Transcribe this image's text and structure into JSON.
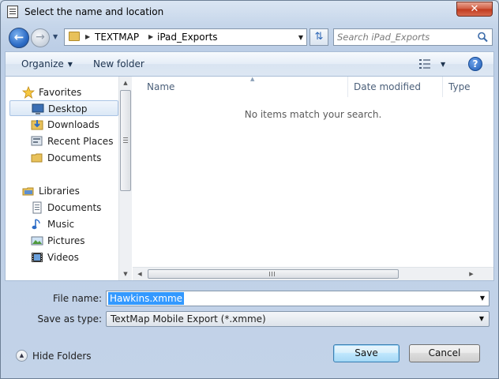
{
  "window": {
    "title": "Select the name and location",
    "close_label": "✕"
  },
  "address": {
    "crumbs": [
      "TEXTMAP",
      "iPad_Exports"
    ],
    "search_placeholder": "Search iPad_Exports"
  },
  "toolbar": {
    "organize_label": "Organize",
    "new_folder_label": "New folder",
    "help_label": "?"
  },
  "nav": {
    "favorites_label": "Favorites",
    "favorites": [
      {
        "label": "Desktop",
        "icon": "desktop-icon",
        "selected": true
      },
      {
        "label": "Downloads",
        "icon": "downloads-icon"
      },
      {
        "label": "Recent Places",
        "icon": "recent-places-icon"
      },
      {
        "label": "Documents",
        "icon": "folder-icon"
      }
    ],
    "libraries_label": "Libraries",
    "libraries": [
      {
        "label": "Documents",
        "icon": "documents-library-icon"
      },
      {
        "label": "Music",
        "icon": "music-icon"
      },
      {
        "label": "Pictures",
        "icon": "pictures-icon"
      },
      {
        "label": "Videos",
        "icon": "videos-icon"
      }
    ]
  },
  "file_list": {
    "columns": [
      "Name",
      "Date modified",
      "Type"
    ],
    "empty_message": "No items match your search."
  },
  "form": {
    "file_name_label": "File name:",
    "file_name_value": "Hawkins.xmme",
    "save_type_label": "Save as type:",
    "save_type_value": "TextMap Mobile Export (*.xmme)"
  },
  "footer": {
    "hide_folders_label": "Hide Folders",
    "save_label": "Save",
    "cancel_label": "Cancel"
  },
  "colors": {
    "selection": "#3399ff",
    "accent": "#2d6cc6"
  }
}
